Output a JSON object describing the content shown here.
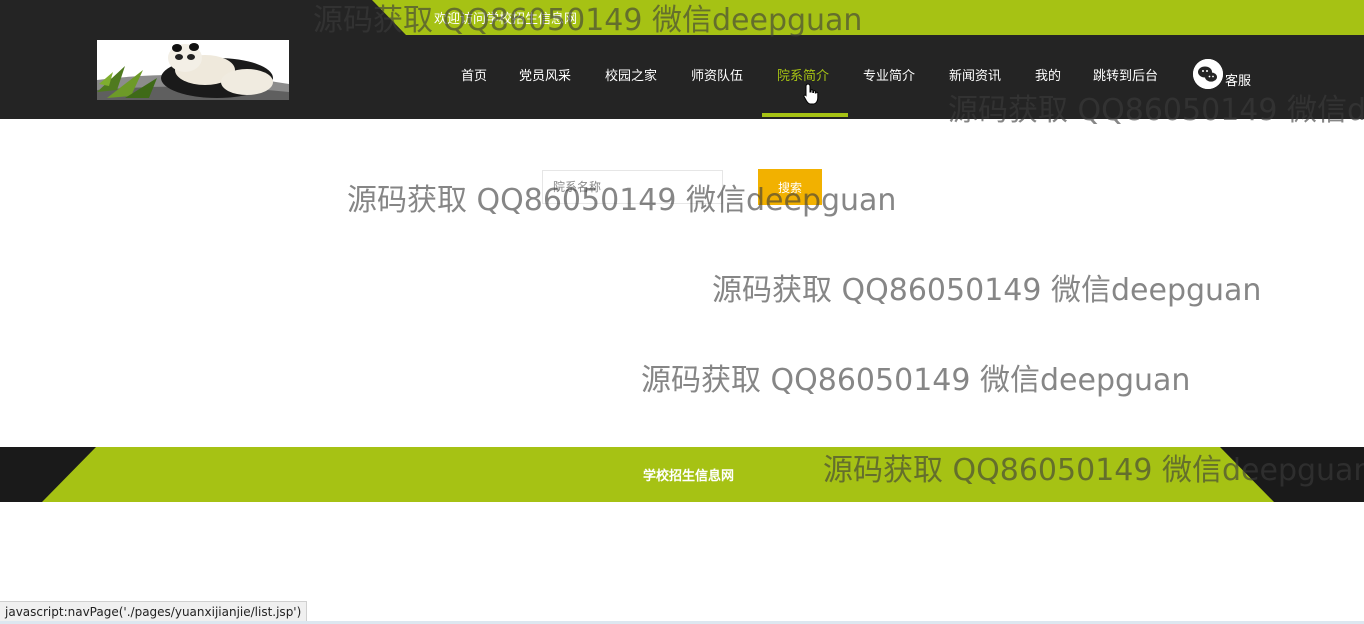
{
  "top": {
    "welcome": "欢迎访问学校招生信息网"
  },
  "nav": {
    "items": [
      {
        "label": "首页"
      },
      {
        "label": "党员风采"
      },
      {
        "label": "校园之家"
      },
      {
        "label": "师资队伍"
      },
      {
        "label": "院系简介",
        "active": true
      },
      {
        "label": "专业简介"
      },
      {
        "label": "新闻资讯"
      },
      {
        "label": "我的"
      },
      {
        "label": "跳转到后台"
      }
    ],
    "kefu_label": "客服",
    "kefu_icon": "wechat-icon"
  },
  "search": {
    "placeholder": "院系名称",
    "button_label": "搜索"
  },
  "footer": {
    "title": "学校招生信息网"
  },
  "status_bar": {
    "url": "javascript:navPage('./pages/yuanxijianjie/list.jsp')"
  },
  "watermark": {
    "text": "源码获取 QQ86050149 微信deepguan"
  },
  "colors": {
    "accent": "#a6c214",
    "header_bg": "#242424",
    "button": "#f2b100"
  }
}
